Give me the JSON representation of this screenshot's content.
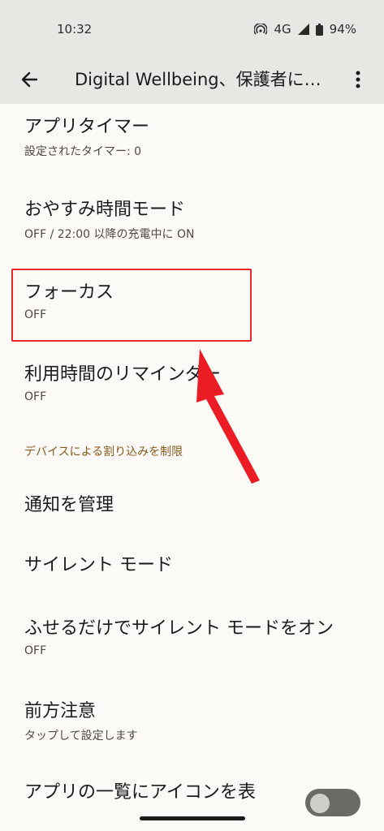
{
  "status_bar": {
    "time": "10:32",
    "network": "4G",
    "battery": "94%"
  },
  "app_bar": {
    "title": "Digital Wellbeing、保護者に…"
  },
  "items": [
    {
      "title": "アプリタイマー",
      "subtitle": "設定されたタイマー: 0"
    },
    {
      "title": "おやすみ時間モード",
      "subtitle": "OFF / 22:00 以降の充電中に ON"
    },
    {
      "title": "フォーカス",
      "subtitle": "OFF"
    },
    {
      "title": "利用時間のリマインダー",
      "subtitle": "OFF"
    }
  ],
  "section": {
    "label": "デバイスによる割り込みを制限"
  },
  "items2": [
    {
      "title": "通知を管理"
    },
    {
      "title": "サイレント モード"
    },
    {
      "title": "ふせるだけでサイレント モードをオン",
      "subtitle": "OFF"
    },
    {
      "title": "前方注意",
      "subtitle": "タップして設定します"
    },
    {
      "title": "アプリの一覧にアイコンを表"
    }
  ],
  "colors": {
    "highlight": "#e8262b",
    "section": "#8a5a1c",
    "topbar": "#e9e7e4"
  },
  "icons": [
    "back-arrow-icon",
    "more-vert-icon",
    "hotspot-icon",
    "signal-icon",
    "battery-icon"
  ]
}
